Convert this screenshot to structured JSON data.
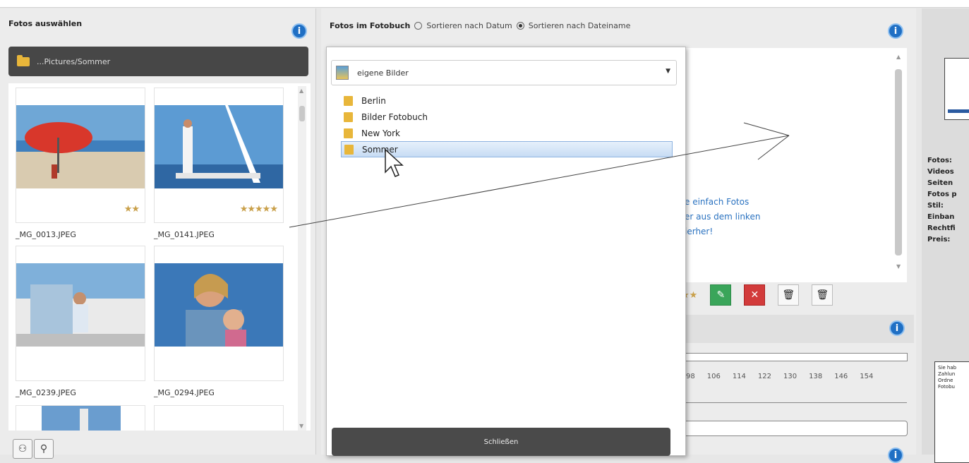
{
  "left_panel": {
    "title": "Fotos auswählen",
    "path": "...Pictures/Sommer",
    "photos": [
      {
        "name": "_MG_0013.JPEG",
        "stars": "★★"
      },
      {
        "name": "_MG_0141.JPEG",
        "stars": "★★★★★"
      },
      {
        "name": "_MG_0239.JPEG",
        "stars": ""
      },
      {
        "name": "_MG_0294.JPEG",
        "stars": ""
      }
    ]
  },
  "middle_panel": {
    "title": "Fotos im Fotobuch",
    "sort_by_date": "Sortieren nach Datum",
    "sort_by_name": "Sortieren nach Dateiname",
    "drop_hint": [
      "e einfach Fotos",
      "er aus dem linken",
      "ierher!"
    ],
    "ruler_ticks": [
      "98",
      "106",
      "114",
      "122",
      "130",
      "138",
      "146",
      "154"
    ]
  },
  "popup": {
    "combo_value": "eigene Bilder",
    "folders": [
      "Berlin",
      "Bilder Fotobuch",
      "New York",
      "Sommer"
    ],
    "selected_folder": "Sommer",
    "close_label": "Schließen"
  },
  "right_panel": {
    "stats": [
      "Fotos:",
      "Videos",
      "Seiten",
      "Fotos p",
      "Stil:",
      "Einban",
      "Rechtfi",
      "Preis:"
    ],
    "note": [
      "Sie hab",
      "Zahlun",
      "Ordne",
      "Fotobu"
    ]
  },
  "icons": {
    "info": "i",
    "trash": "🗑"
  },
  "colors": {
    "accent": "#1f6fc4",
    "dark_bar": "#474747",
    "link_text": "#2a72c0"
  }
}
